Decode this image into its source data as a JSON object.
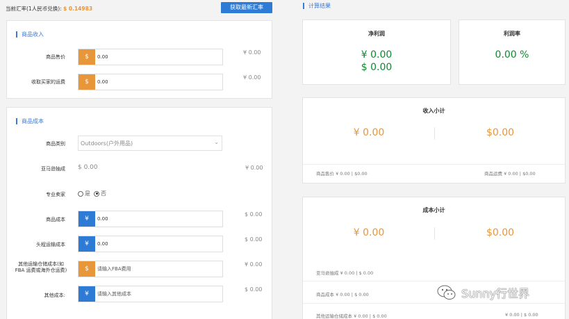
{
  "header": {
    "rate_label": "当前汇率(1人民币兑换):",
    "rate_value": "$ 0.14983",
    "refresh_button": "获取最新汇率"
  },
  "income": {
    "title": "商品收入",
    "rows": [
      {
        "label": "商品售价",
        "addon": "$",
        "value": "0.00",
        "right": "¥ 0.00"
      },
      {
        "label": "收取买家的运费",
        "addon": "$",
        "value": "0.00",
        "right": "¥ 0.00"
      }
    ]
  },
  "cost": {
    "title": "商品成本",
    "category_label": "商品类别",
    "category_value": "Outdoors(户外用品)",
    "commission_label": "亚马逊抽成",
    "commission_value": "$ 0.00",
    "commission_right": "¥ 0.00",
    "seller_label": "专业卖家",
    "radio_yes": "是",
    "radio_no": "否",
    "product_cost_label": "商品成本",
    "product_cost_addon": "¥",
    "product_cost_value": "0.00",
    "product_cost_right": "$ 0.00",
    "shipping_label": "头程运输成本",
    "shipping_addon": "¥",
    "shipping_value": "0.00",
    "shipping_right": "$ 0.00",
    "other_ship_label": "其他运输仓储成本(如FBA 运费或海外仓运费)",
    "other_ship_addon": "$",
    "other_ship_placeholder": "请输入FBA费用",
    "other_ship_right": "¥ 0.00",
    "other_cost_label": "其他成本:",
    "other_cost_addon": "¥",
    "other_cost_placeholder": "请输入其他成本",
    "other_cost_right": "$ 0.00"
  },
  "results": {
    "title": "计算结果",
    "net_profit_title": "净利润",
    "net_profit_cny": "¥ 0.00",
    "net_profit_usd": "$ 0.00",
    "margin_title": "利润率",
    "margin_value": "0.00 %",
    "income_subtotal_title": "收入小计",
    "income_subtotal_cny": "¥ 0.00",
    "income_subtotal_usd": "$0.00",
    "income_detail_left": "商品售价  ¥ 0.00   |   $0.00",
    "income_detail_right": "商品运费  ¥ 0.00   |   $0.00",
    "cost_subtotal_title": "成本小计",
    "cost_subtotal_cny": "¥ 0.00",
    "cost_subtotal_usd": "$0.00",
    "cost_detail_1": "亚马逊抽成  ¥ 0.00   |   $ 0.00",
    "cost_detail_2": "商品成本  ¥ 0.00   |   $ 0.00",
    "cost_detail_3": "其他运输仓储成本  ¥ 0.00   |   $ 0.00",
    "cost_detail_3b": "¥ 0.00   |   $ 0.00"
  },
  "watermark": "Sunny行世界",
  "colors": {
    "accent": "#2e7bd6",
    "orange": "#e8963a",
    "green": "#0e8a2e"
  }
}
